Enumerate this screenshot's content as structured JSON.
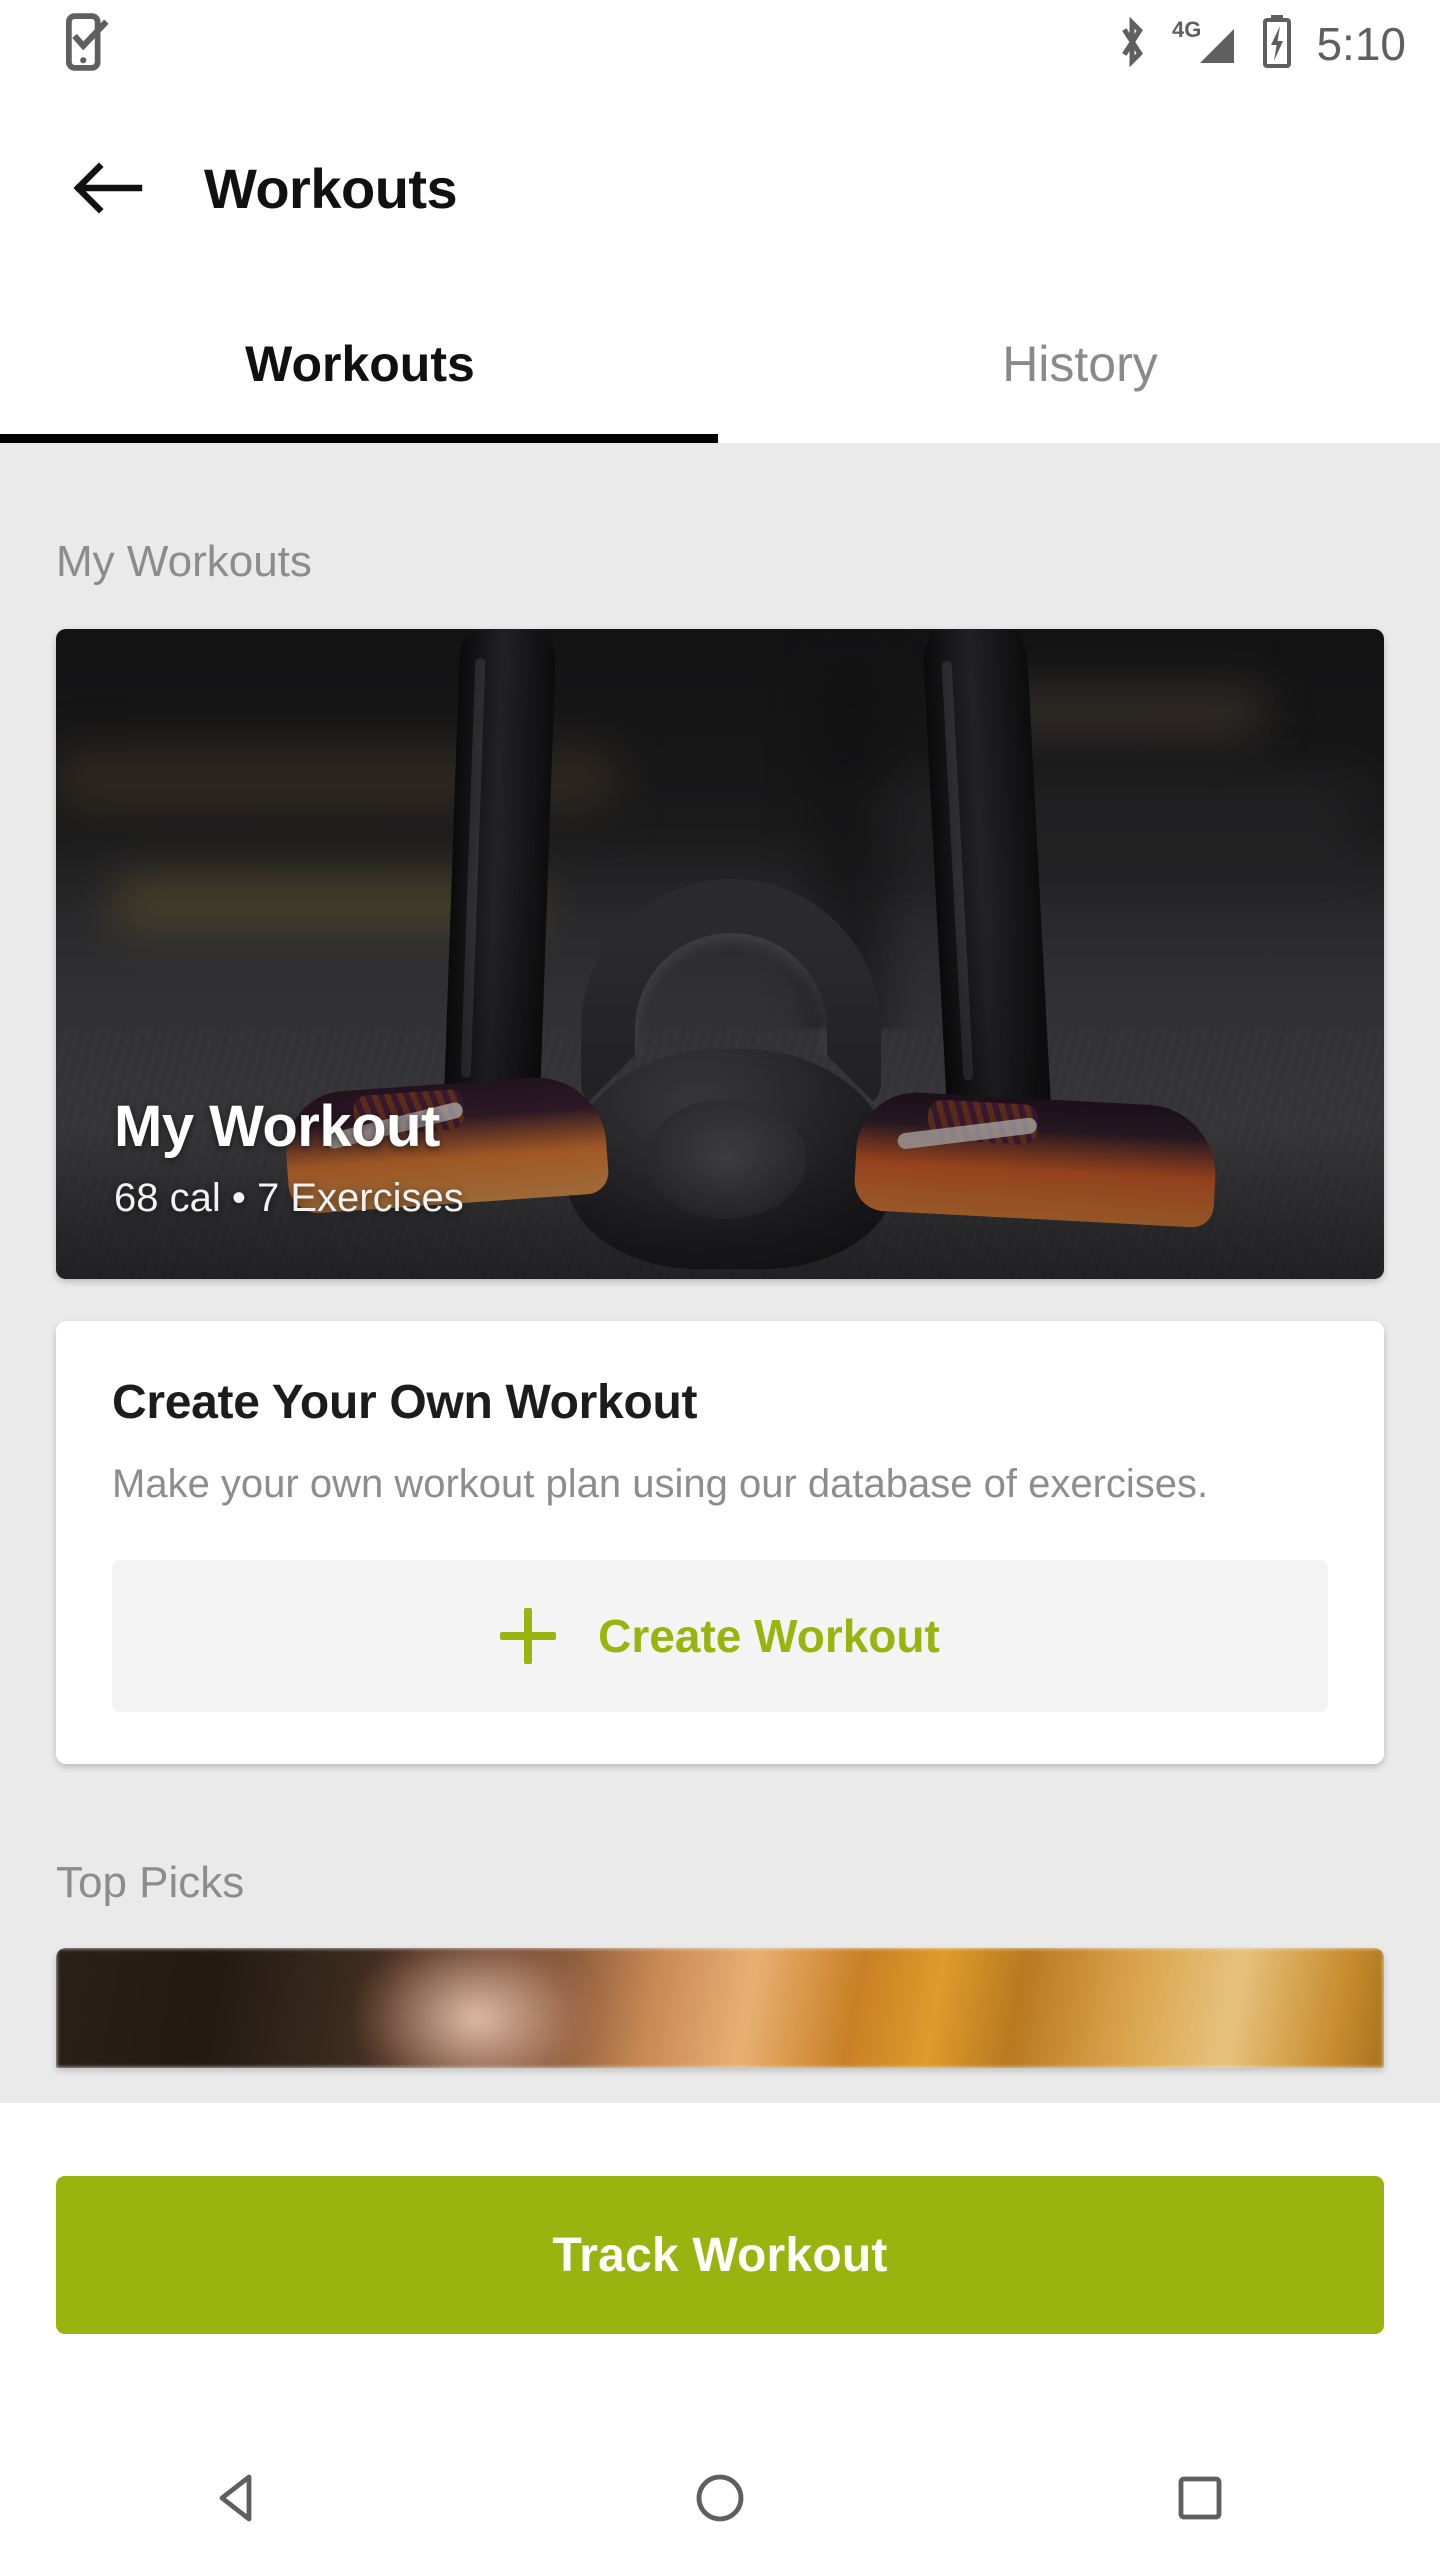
{
  "status_bar": {
    "left_icons": [
      {
        "name": "phone-check-icon",
        "glyph": "phone-check"
      }
    ],
    "right_icons": [
      {
        "name": "bluetooth-icon",
        "glyph": "bluetooth"
      },
      {
        "name": "signal-4g-icon",
        "glyph": "4G",
        "label": "4G"
      },
      {
        "name": "battery-charging-icon",
        "glyph": "battery-bolt"
      }
    ],
    "time": "5:10"
  },
  "app_bar": {
    "back_label": "←",
    "title": "Workouts"
  },
  "tabs": {
    "items": [
      {
        "label": "Workouts",
        "active": true
      },
      {
        "label": "History",
        "active": false
      }
    ],
    "active_index": 0
  },
  "sections": {
    "my_workouts": {
      "title": "My Workouts",
      "hero_card": {
        "title": "My Workout",
        "subtitle": "68 cal • 7 Exercises",
        "calories": "68 cal",
        "exercises": "7 Exercises"
      },
      "create_card": {
        "title": "Create Your Own Workout",
        "description": "Make your own workout plan using our database of exercises.",
        "button_label": "Create Workout",
        "button_icon": "plus-icon"
      }
    },
    "top_picks": {
      "title": "Top Picks"
    }
  },
  "bottom_bar": {
    "primary_action": "Track Workout"
  },
  "nav_bar": {
    "back": "back-triangle",
    "home": "home-circle",
    "recents": "recents-square"
  },
  "colors": {
    "accent_green": "#9ab40f",
    "background_gray": "#eaeaea",
    "card_white": "#ffffff",
    "text_primary": "#111111",
    "text_secondary": "#8c8c8c",
    "tab_indicator": "#000000"
  }
}
